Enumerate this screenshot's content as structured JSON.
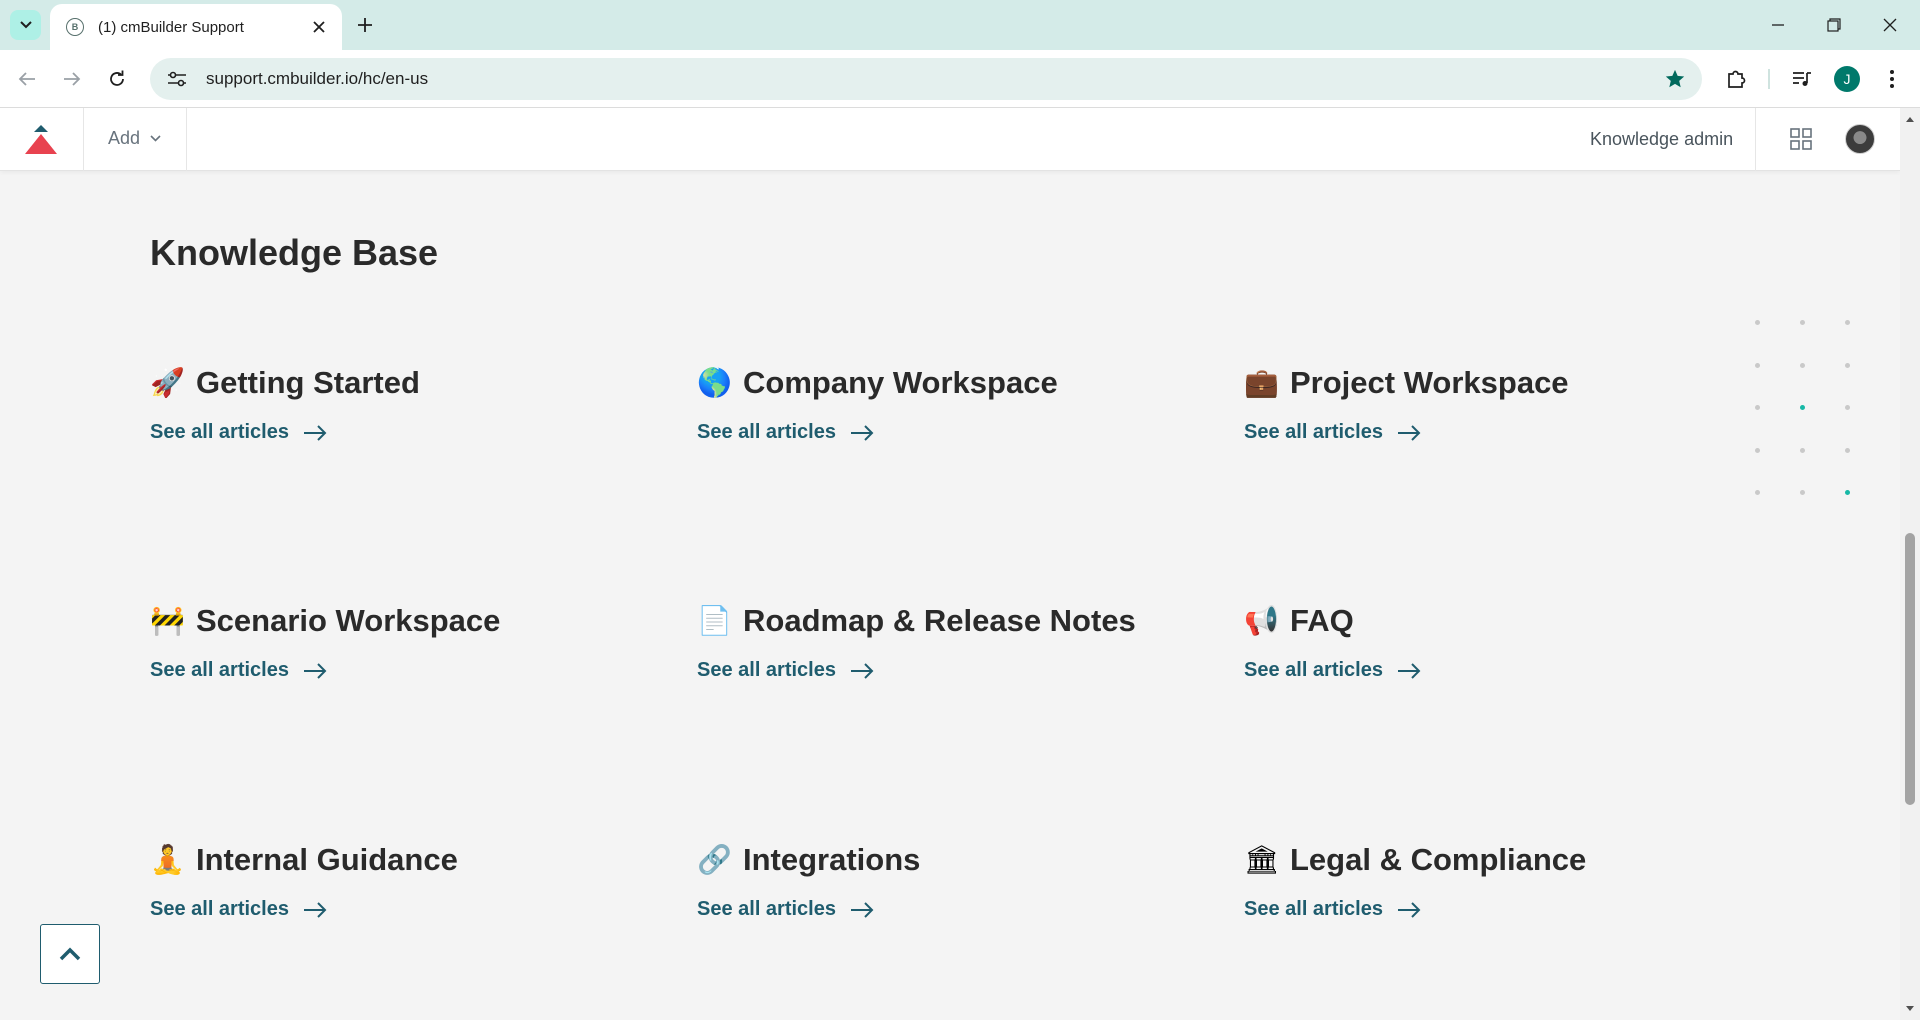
{
  "browser": {
    "tab_title": "(1) cmBuilder Support",
    "url": "support.cmbuilder.io/hc/en-us",
    "profile_initial": "J"
  },
  "header": {
    "add_label": "Add",
    "admin_label": "Knowledge admin"
  },
  "kb": {
    "title": "Knowledge Base",
    "categories": [
      {
        "emoji": "🚀",
        "name": "Getting Started",
        "link": "See all articles"
      },
      {
        "emoji": "🌎",
        "name": "Company Workspace",
        "link": "See all articles"
      },
      {
        "emoji": "💼",
        "name": "Project Workspace",
        "link": "See all articles"
      },
      {
        "emoji": "🚧",
        "name": "Scenario Workspace",
        "link": "See all articles"
      },
      {
        "emoji": "📄",
        "name": "Roadmap & Release Notes",
        "link": "See all articles"
      },
      {
        "emoji": "📢",
        "name": "FAQ",
        "link": "See all articles"
      },
      {
        "emoji": "🧘",
        "name": "Internal Guidance",
        "link": "See all articles"
      },
      {
        "emoji": "🔗",
        "name": "Integrations",
        "link": "See all articles"
      },
      {
        "emoji": "🏛",
        "name": "Legal & Compliance",
        "link": "See all articles"
      }
    ]
  },
  "colors": {
    "accent": "#1f5c6e",
    "teal": "#17b8a6",
    "logo_red": "#e8424f",
    "logo_dark": "#1f5c6e"
  }
}
